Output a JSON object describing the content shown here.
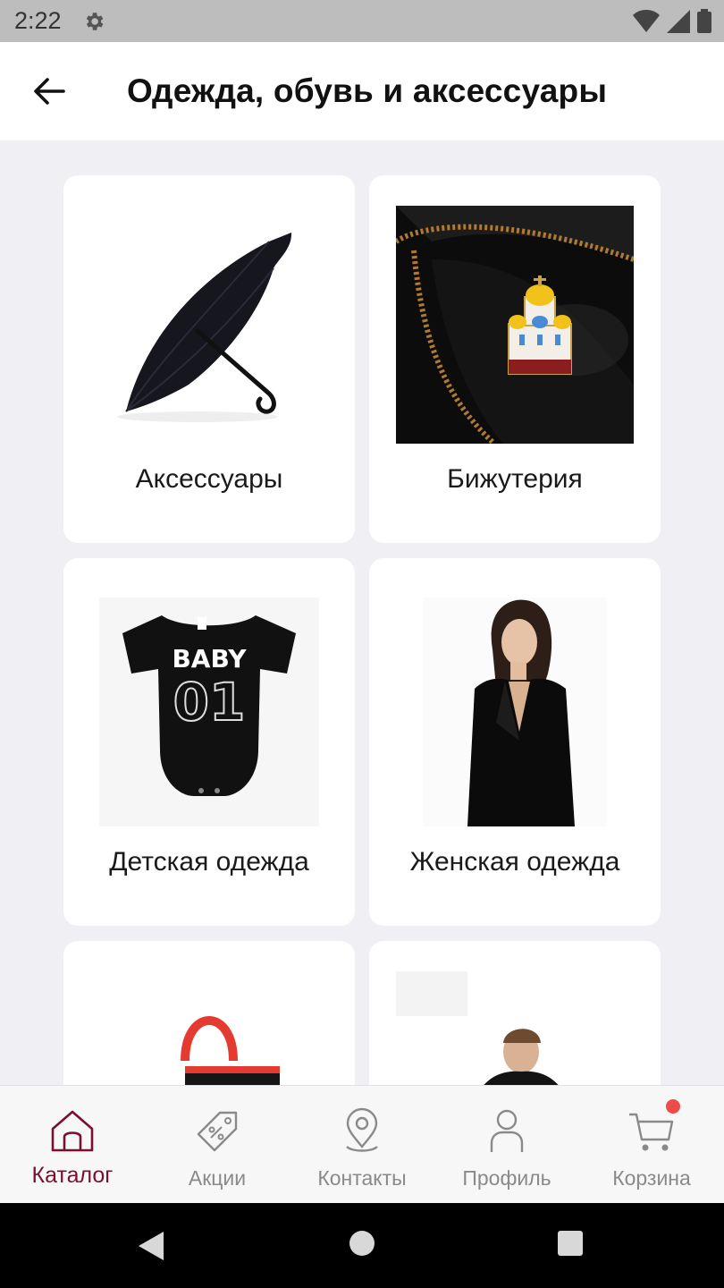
{
  "status_bar": {
    "time": "2:22"
  },
  "header": {
    "title": "Одежда, обувь и аксессуары"
  },
  "categories": [
    {
      "label": "Аксессуары"
    },
    {
      "label": "Бижутерия"
    },
    {
      "label": "Детская одежда"
    },
    {
      "label": "Женская одежда"
    },
    {
      "label": ""
    },
    {
      "label": ""
    }
  ],
  "baby_print": {
    "line1": "BABY",
    "line2": "01"
  },
  "bottom_nav": {
    "items": [
      {
        "label": "Каталог",
        "icon": "home-icon",
        "active": true
      },
      {
        "label": "Акции",
        "icon": "tag-icon",
        "active": false
      },
      {
        "label": "Контакты",
        "icon": "location-pin-icon",
        "active": false
      },
      {
        "label": "Профиль",
        "icon": "user-icon",
        "active": false
      },
      {
        "label": "Корзина",
        "icon": "cart-icon",
        "active": false
      }
    ]
  },
  "colors": {
    "accent": "#7a1030",
    "badge": "#f04b4b",
    "background": "#efeff4",
    "inactive": "#8a8a8a"
  }
}
